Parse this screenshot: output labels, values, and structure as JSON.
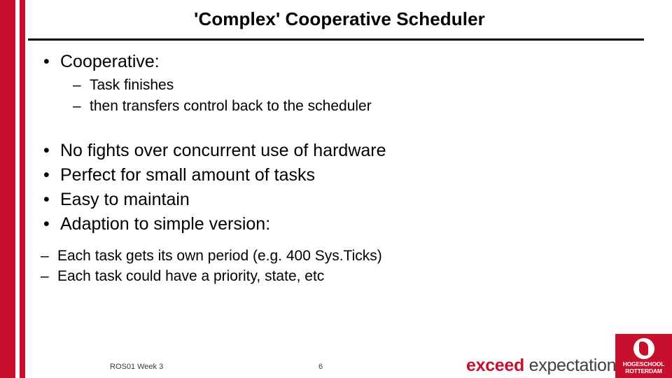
{
  "slide": {
    "title": "'Complex' Cooperative Scheduler",
    "groups": [
      {
        "bullet_char": "•",
        "text": "Cooperative:",
        "sub": [
          {
            "dash_char": "–",
            "text": "Task finishes"
          },
          {
            "dash_char": "–",
            "text": "then transfers control back to the scheduler"
          }
        ]
      }
    ],
    "main_bullets": [
      {
        "bullet_char": "•",
        "text": "No fights over concurrent use of hardware"
      },
      {
        "bullet_char": "•",
        "text": "Perfect for small amount of tasks"
      },
      {
        "bullet_char": "•",
        "text": "Easy to maintain"
      },
      {
        "bullet_char": "•",
        "text": "Adaption to simple version:"
      }
    ],
    "final_sub": [
      {
        "dash_char": "–",
        "text": "Each task gets its own period (e.g. 400 Sys.Ticks)"
      },
      {
        "dash_char": "–",
        "text": "Each task could have a priority, state,  etc"
      }
    ]
  },
  "footer": {
    "course": "ROS01 Week 3",
    "page_number": "6",
    "tagline_bold": "exceed",
    "tagline_light": " expectations",
    "logo_line1": "HOGESCHOOL",
    "logo_line2": "ROTTERDAM"
  },
  "colors": {
    "accent_red": "#c8102e",
    "text": "#000000",
    "footer_text": "#3a3a3a"
  }
}
